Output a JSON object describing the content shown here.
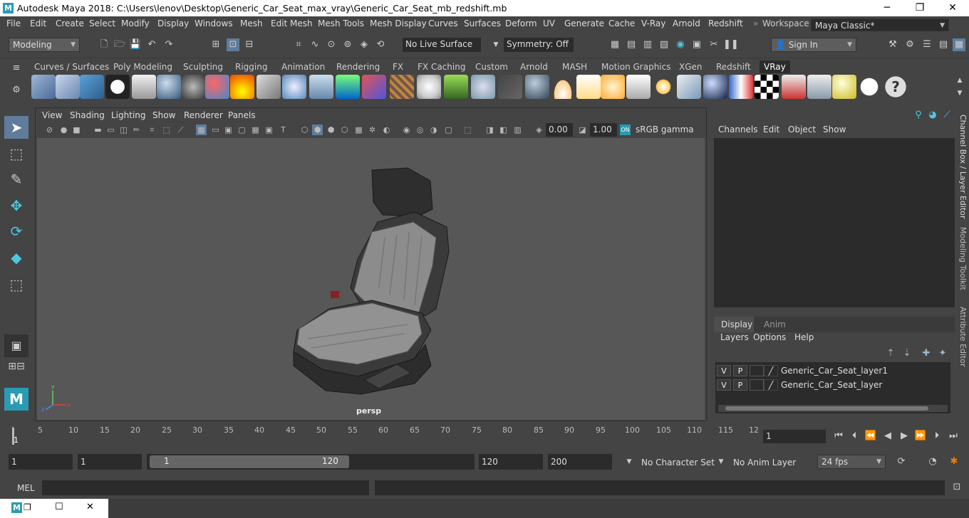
{
  "window": {
    "title": "Autodesk Maya 2018: C:\\Users\\lenov\\Desktop\\Generic_Car_Seat_max_vray\\Generic_Car_Seat_mb_redshift.mb",
    "logo_glyph": "M",
    "minimize": "─",
    "maximize": "❐",
    "close": "✕"
  },
  "menu": [
    "File",
    "Edit",
    "Create",
    "Select",
    "Modify",
    "Display",
    "Windows",
    "Mesh",
    "Edit Mesh",
    "Mesh Tools",
    "Mesh Display",
    "Curves",
    "Surfaces",
    "Deform",
    "UV",
    "Generate",
    "Cache",
    "V-Ray",
    "Arnold",
    "Redshift"
  ],
  "workspace": {
    "label": "Workspace :",
    "value": "Maya Classic*"
  },
  "status": {
    "mode": "Modeling",
    "live_surface": "No Live Surface",
    "symmetry": "Symmetry: Off",
    "sign_in": "Sign In"
  },
  "shelf_tabs": [
    "Curves / Surfaces",
    "Poly Modeling",
    "Sculpting",
    "Rigging",
    "Animation",
    "Rendering",
    "FX",
    "FX Caching",
    "Custom",
    "Arnold",
    "MASH",
    "Motion Graphics",
    "XGen",
    "Redshift",
    "VRay"
  ],
  "shelf_active": "VRay",
  "viewport": {
    "menu": [
      "View",
      "Shading",
      "Lighting",
      "Show",
      "Renderer",
      "Panels"
    ],
    "exposure": "0.00",
    "gamma": "1.00",
    "color_space": "sRGB gamma",
    "camera": "persp"
  },
  "channel_box": {
    "menu": [
      "Channels",
      "Edit",
      "Object",
      "Show"
    ]
  },
  "layer_editor": {
    "tabs": [
      "Display",
      "Anim"
    ],
    "active_tab": "Display",
    "menu": [
      "Layers",
      "Options",
      "Help"
    ],
    "layers": [
      {
        "v": "V",
        "p": "P",
        "name": "Generic_Car_Seat_layer1"
      },
      {
        "v": "V",
        "p": "P",
        "name": "Generic_Car_Seat_layer"
      }
    ]
  },
  "side_tabs": [
    "Channel Box / Layer Editor",
    "Modeling Toolkit",
    "Attribute Editor"
  ],
  "timeline": {
    "ticks": [
      "1",
      "5",
      "10",
      "15",
      "20",
      "25",
      "30",
      "35",
      "40",
      "45",
      "50",
      "55",
      "60",
      "65",
      "70",
      "75",
      "80",
      "85",
      "90",
      "95",
      "100",
      "105",
      "110",
      "115",
      "12"
    ],
    "current_frame": "1"
  },
  "range": {
    "start": "1",
    "playback_start": "1",
    "slider_start": "1",
    "slider_end": "120",
    "playback_end": "120",
    "end": "200",
    "character_set": "No Character Set",
    "anim_layer": "No Anim Layer",
    "fps": "24 fps"
  },
  "command": {
    "label": "MEL"
  }
}
